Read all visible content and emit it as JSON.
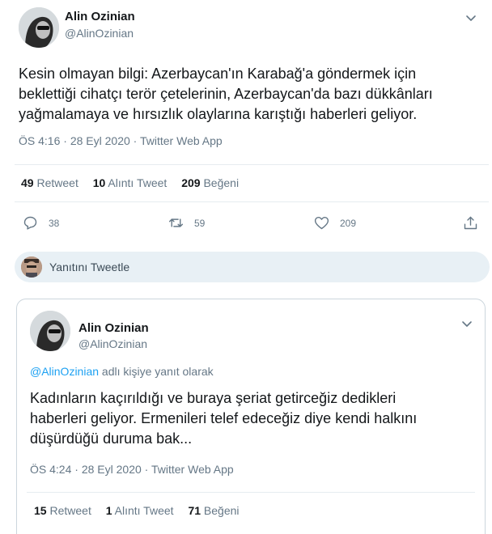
{
  "main_tweet": {
    "author_name": "Alin Ozinian",
    "author_handle": "@AlinOzinian",
    "text_lines": [
      "Kesin olmayan bilgi: Azerbaycan'ın Karabağ'a göndermek için",
      "beklettiği cihatçı terör çetelerinin, Azerbaycan'da bazı dükkânları",
      "yağmalamaya ve hırsızlık olaylarına karıştığı haberleri geliyor."
    ],
    "time": "ÖS 4:16",
    "date": "28 Eyl 2020",
    "dot": "·",
    "source": "Twitter Web App",
    "stats": {
      "retweets": "49",
      "retweets_label": "Retweet",
      "quotes": "10",
      "quotes_label": "Alıntı Tweet",
      "likes": "209",
      "likes_label": "Beğeni"
    },
    "actions": {
      "reply_count": "38",
      "retweet_count": "59",
      "like_count": "209"
    }
  },
  "reply_box": {
    "placeholder": "Yanıtını Tweetle"
  },
  "reply_tweet": {
    "author_name": "Alin Ozinian",
    "author_handle": "@AlinOzinian",
    "replying_mention": "@AlinOzinian",
    "replying_suffix": "adlı kişiye yanıt olarak",
    "text_lines": [
      "Kadınların kaçırıldığı ve buraya şeriat getirceğiz dedikleri",
      "haberleri geliyor. Ermenileri telef edeceğiz diye kendi halkını",
      "düşürdüğü duruma bak..."
    ],
    "time": "ÖS 4:24",
    "date": "28 Eyl 2020",
    "dot": "·",
    "source": "Twitter Web App",
    "stats": {
      "retweets": "15",
      "retweets_label": "Retweet",
      "quotes": "1",
      "quotes_label": "Alıntı Tweet",
      "likes": "71",
      "likes_label": "Beğeni"
    }
  },
  "icons": {
    "more": "chevron-down-icon",
    "reply": "comment-icon",
    "retweet": "retweet-icon",
    "like": "heart-icon",
    "share": "share-icon"
  },
  "colors": {
    "link": "#1da1f2",
    "secondary_text": "#657786",
    "reply_bar": "#e8f0f5"
  }
}
